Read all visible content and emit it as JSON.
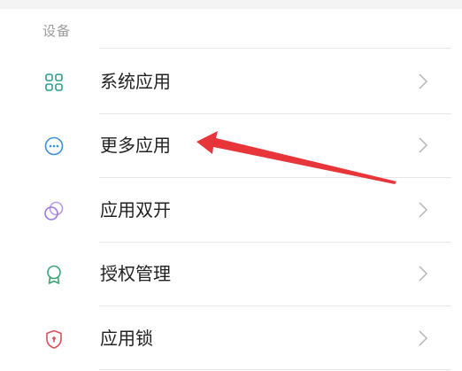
{
  "section": {
    "title": "设备"
  },
  "items": [
    {
      "label": "系统应用",
      "icon": "grid-apps-icon",
      "color": "#2e9e8f"
    },
    {
      "label": "更多应用",
      "icon": "more-dots-icon",
      "color": "#3b8fd6"
    },
    {
      "label": "应用双开",
      "icon": "dual-app-icon",
      "color": "#9a7ad8"
    },
    {
      "label": "授权管理",
      "icon": "badge-award-icon",
      "color": "#3aa676"
    },
    {
      "label": "应用锁",
      "icon": "shield-lock-icon",
      "color": "#d8505a"
    }
  ],
  "annotation": {
    "arrow_color": "#e8353a",
    "points_to": "更多应用"
  }
}
